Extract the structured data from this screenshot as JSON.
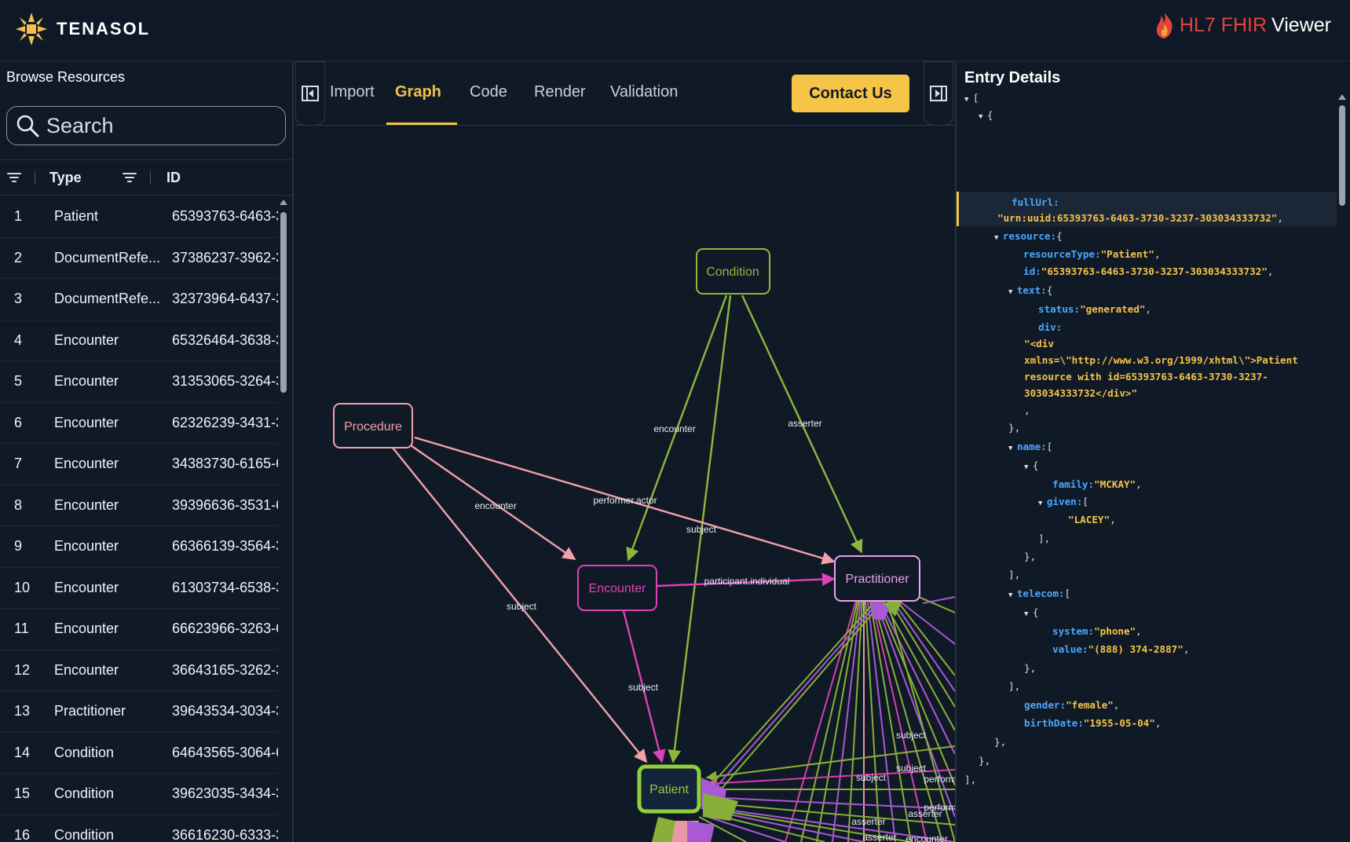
{
  "header": {
    "logo_text": "TENASOL",
    "brand_hl7": "HL7 FHIR",
    "brand_viewer": "Viewer",
    "logo_color": "#f2c14a"
  },
  "left_panel": {
    "title": "Browse Resources",
    "search_placeholder": "Search",
    "columns": [
      "Type",
      "ID"
    ],
    "rows": [
      {
        "num": "1",
        "type": "Patient",
        "id": "65393763-6463-3"
      },
      {
        "num": "2",
        "type": "DocumentRefe...",
        "id": "37386237-3962-3"
      },
      {
        "num": "3",
        "type": "DocumentRefe...",
        "id": "32373964-6437-3"
      },
      {
        "num": "4",
        "type": "Encounter",
        "id": "65326464-3638-3"
      },
      {
        "num": "5",
        "type": "Encounter",
        "id": "31353065-3264-3"
      },
      {
        "num": "6",
        "type": "Encounter",
        "id": "62326239-3431-3"
      },
      {
        "num": "7",
        "type": "Encounter",
        "id": "34383730-6165-6"
      },
      {
        "num": "8",
        "type": "Encounter",
        "id": "39396636-3531-6"
      },
      {
        "num": "9",
        "type": "Encounter",
        "id": "66366139-3564-3"
      },
      {
        "num": "10",
        "type": "Encounter",
        "id": "61303734-6538-3"
      },
      {
        "num": "11",
        "type": "Encounter",
        "id": "66623966-3263-6"
      },
      {
        "num": "12",
        "type": "Encounter",
        "id": "36643165-3262-3"
      },
      {
        "num": "13",
        "type": "Practitioner",
        "id": "39643534-3034-3"
      },
      {
        "num": "14",
        "type": "Condition",
        "id": "64643565-3064-6"
      },
      {
        "num": "15",
        "type": "Condition",
        "id": "39623035-3434-3"
      },
      {
        "num": "16",
        "type": "Condition",
        "id": "36616230-6333-3"
      }
    ]
  },
  "tabs": {
    "import": "Import",
    "graph": "Graph",
    "code": "Code",
    "render": "Render",
    "validation": "Validation",
    "active": "Graph",
    "contact": "Contact Us"
  },
  "graph": {
    "nodes": {
      "condition": "Condition",
      "procedure": "Procedure",
      "encounter": "Encounter",
      "practitioner": "Practitioner",
      "patient": "Patient"
    },
    "edge_labels": {
      "cond_enc": "encounter",
      "cond_prac": "asserter",
      "proc_enc": "encounter",
      "proc_prac": "performer.actor",
      "cond_pat": "subject",
      "enc_prac": "participant.individual",
      "proc_pat": "subject",
      "enc_pat": "subject",
      "cluster_1": "subject",
      "cluster_2": "subject",
      "cluster_3": "subject",
      "cluster_4": "perform",
      "cluster_5": "perform",
      "cluster_6": "asserter",
      "cluster_7": "asserter",
      "cluster_8": "asserter",
      "cluster_9": "encounter"
    },
    "colors": {
      "condition": "#8fb83a",
      "procedure": "#f2a0aa",
      "encounter": "#e040b8",
      "practitioner": "#e7a3f0",
      "patient": "#8fd13a"
    }
  },
  "entry": {
    "title": "Entry Details",
    "lines": {
      "l0": "[",
      "l1": "{",
      "fullurl_key": "fullUrl:",
      "fullurl_val": "\"urn:uuid:65393763-6463-3730-3237-303034333732\"",
      "resource_key": "resource:",
      "resourcetype_key": "resourceType:",
      "resourcetype_val": "\"Patient\"",
      "id_key": "id:",
      "id_val": "\"65393763-6463-3730-3237-303034333732\"",
      "text_key": "text:",
      "status_key": "status:",
      "status_val": "\"generated\"",
      "div_key": "div:",
      "div_val_1": "\"<div",
      "div_val_2": "xmlns=\\\"http://www.w3.org/1999/xhtml\\\">Patient",
      "div_val_3": "resource with id=65393763-6463-3730-3237-",
      "div_val_4": "303034333732</div>\"",
      "name_key": "name:",
      "family_key": "family:",
      "family_val": "\"MCKAY\"",
      "given_key": "given:",
      "given_val": "\"LACEY\"",
      "telecom_key": "telecom:",
      "system_key": "system:",
      "system_val": "\"phone\"",
      "value_key": "value:",
      "value_val": "\"(888) 374-2887\"",
      "gender_key": "gender:",
      "gender_val": "\"female\"",
      "birthdate_key": "birthDate:",
      "birthdate_val": "\"1955-05-04\""
    }
  }
}
